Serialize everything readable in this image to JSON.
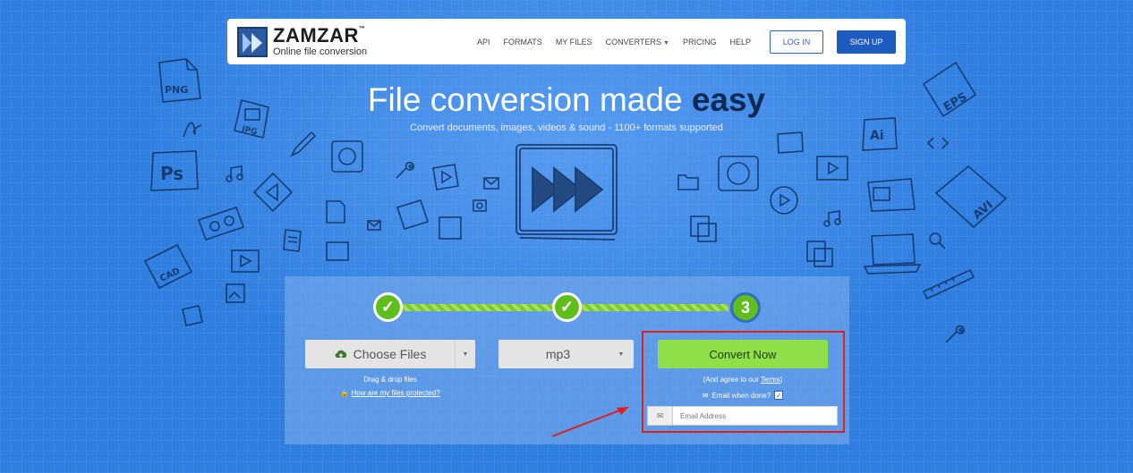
{
  "header": {
    "brand": "ZAMZAR",
    "brand_tm": "™",
    "tagline": "Online file conversion",
    "nav": [
      "API",
      "FORMATS",
      "MY FILES",
      "CONVERTERS",
      "PRICING",
      "HELP"
    ],
    "login": "LOG IN",
    "signup": "SIGN UP"
  },
  "hero": {
    "title_main": "File conversion made ",
    "title_bold": "easy",
    "subtitle": "Convert documents, images, videos & sound - 1100+ formats supported"
  },
  "converter": {
    "steps": [
      {
        "label": "✓",
        "state": "done"
      },
      {
        "label": "✓",
        "state": "done"
      },
      {
        "label": "3",
        "state": "current"
      }
    ],
    "choose_files": "Choose Files",
    "drag_drop": "Drag & drop files",
    "protected_link": "How are my files protected?",
    "format_value": "mp3",
    "convert_now": "Convert Now",
    "agree_prefix": "(And agree to our ",
    "agree_terms": "Terms",
    "agree_suffix": ")",
    "email_when_done": "Email when done?",
    "email_checked": "✓",
    "email_placeholder": "Email Address"
  },
  "decor_icons": [
    "PNG",
    "JPG",
    "Ps",
    "CAD",
    "EPS",
    "Ai",
    "AVI"
  ],
  "colors": {
    "background": "#2f7ee0",
    "signup_bg": "#1e5bbf",
    "convert_bg": "#8fdf4a",
    "step_done": "#5fbe1e",
    "highlight": "#e0201c"
  }
}
